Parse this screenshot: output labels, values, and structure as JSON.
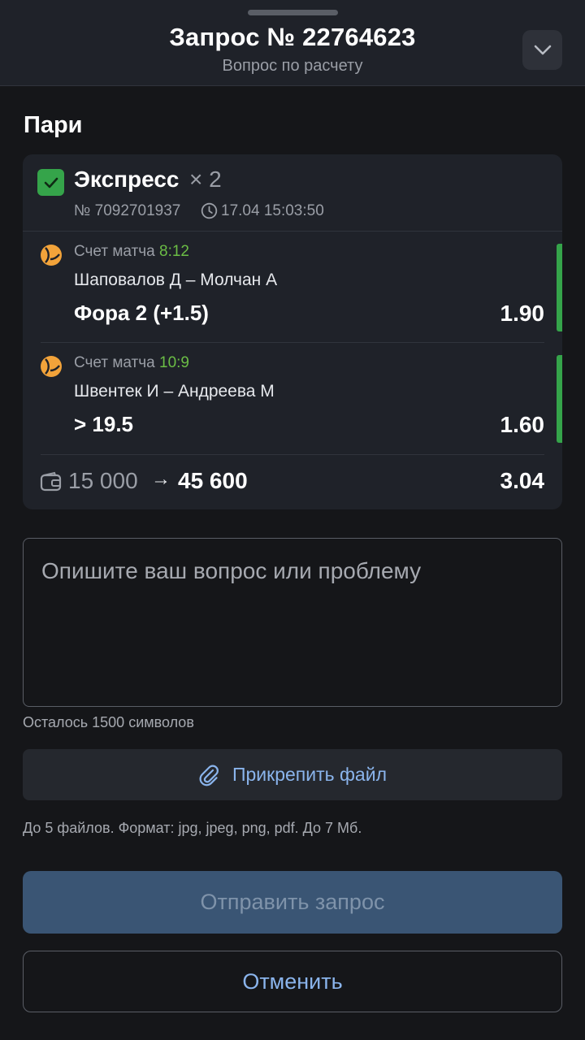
{
  "header": {
    "title": "Запрос № 22764623",
    "subtitle": "Вопрос по расчету",
    "collapse_icon": "chevron-down-icon"
  },
  "section": {
    "title": "Пари"
  },
  "bet": {
    "type": "Экспресс",
    "count": "× 2",
    "number": "№ 7092701937",
    "datetime": "17.04 15:03:50",
    "status": "won",
    "status_color": "#35a44a",
    "events": [
      {
        "sport_icon": "tennis-ball-icon",
        "market": "Счет матча",
        "score": "8:12",
        "teams": "Шаповалов Д – Молчан А",
        "outcome": "Фора 2 (+1.5)",
        "odds": "1.90"
      },
      {
        "sport_icon": "tennis-ball-icon",
        "market": "Счет матча",
        "score": "10:9",
        "teams": "Швентек И – Андреева М",
        "outcome": "> 19.5",
        "odds": "1.60"
      }
    ],
    "stake": "15 000",
    "arrow": "→",
    "payout": "45 600",
    "total_odds": "3.04"
  },
  "form": {
    "question_placeholder": "Опишите ваш вопрос или проблему",
    "question_value": "",
    "chars_left": "Осталось 1500 символов",
    "attach_label": "Прикрепить файл",
    "files_hint": "До 5 файлов. Формат: jpg, jpeg, png, pdf. До 7 Мб.",
    "submit_label": "Отправить запрос",
    "cancel_label": "Отменить"
  },
  "colors": {
    "background": "#151619",
    "card": "#1f2229",
    "accent_link": "#8ab4ec",
    "score_green": "#6bbd45",
    "sport_icon": "#f2a33a",
    "submit_disabled": "#3a5574"
  }
}
